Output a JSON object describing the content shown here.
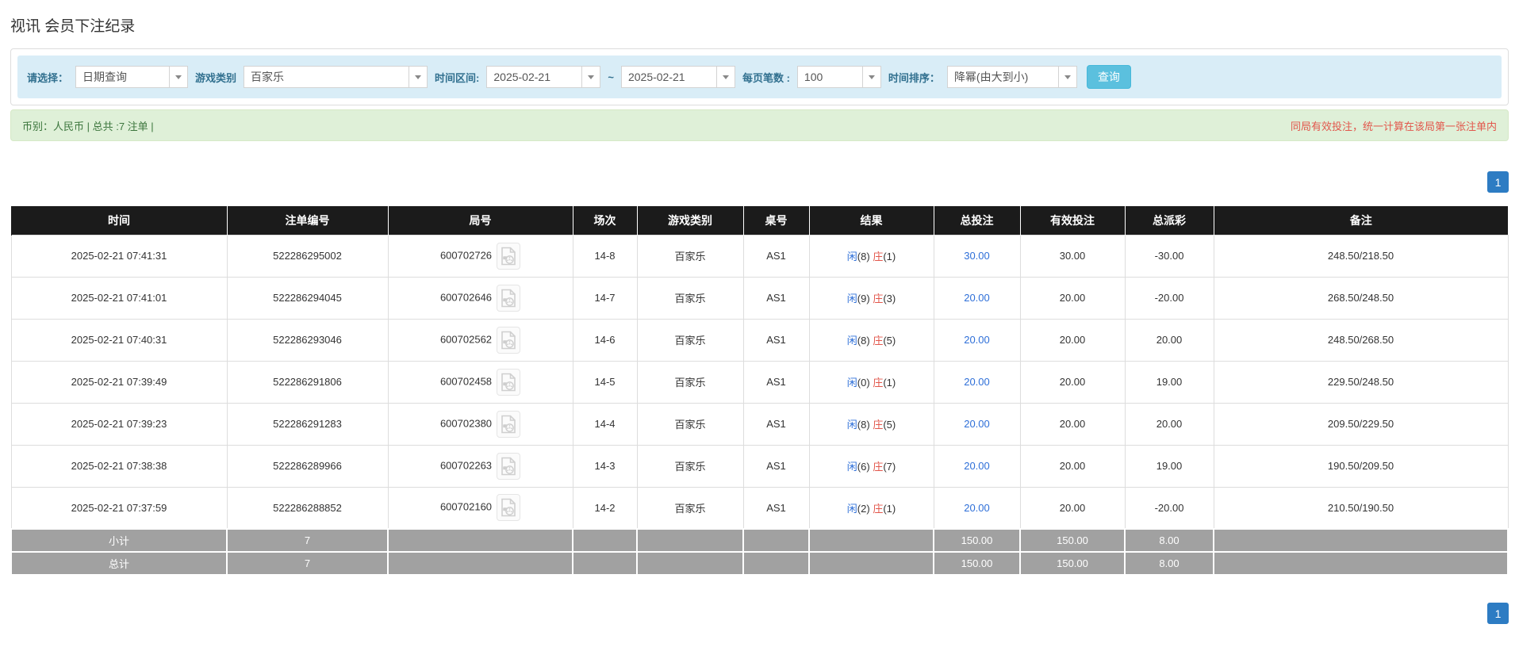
{
  "page": {
    "title": "视讯 会员下注纪录"
  },
  "filters": {
    "select_label": "请选择：",
    "select_value": "日期查询",
    "game_label": "游戏类别",
    "game_value": "百家乐",
    "range_label": "时间区间:",
    "date_from": "2025-02-21",
    "range_separator": "~",
    "date_to": "2025-02-21",
    "page_size_label": "每页笔数 :",
    "page_size_value": "100",
    "sort_label": "时间排序：",
    "sort_value": "降幂(由大到小)",
    "search_button": "查询"
  },
  "summary_bar": {
    "left_text": "币别：人民币 | 总共 :7 注单 |",
    "right_text": "同局有效投注，统一计算在该局第一张注单内"
  },
  "pagination": {
    "page": "1"
  },
  "table": {
    "headers": [
      "时间",
      "注单编号",
      "局号",
      "场次",
      "游戏类别",
      "桌号",
      "结果",
      "总投注",
      "有效投注",
      "总派彩",
      "备注"
    ],
    "rows": [
      {
        "time": "2025-02-21 07:41:31",
        "bet_no": "522286295002",
        "round_no": "600702726",
        "session": "14-8",
        "game": "百家乐",
        "table_no": "AS1",
        "player": "闲",
        "player_score": "(8)",
        "banker": "庄",
        "banker_score": "(1)",
        "total_bet": "30.00",
        "valid_bet": "30.00",
        "payout": "-30.00",
        "note": "248.50/218.50"
      },
      {
        "time": "2025-02-21 07:41:01",
        "bet_no": "522286294045",
        "round_no": "600702646",
        "session": "14-7",
        "game": "百家乐",
        "table_no": "AS1",
        "player": "闲",
        "player_score": "(9)",
        "banker": "庄",
        "banker_score": "(3)",
        "total_bet": "20.00",
        "valid_bet": "20.00",
        "payout": "-20.00",
        "note": "268.50/248.50"
      },
      {
        "time": "2025-02-21 07:40:31",
        "bet_no": "522286293046",
        "round_no": "600702562",
        "session": "14-6",
        "game": "百家乐",
        "table_no": "AS1",
        "player": "闲",
        "player_score": "(8)",
        "banker": "庄",
        "banker_score": "(5)",
        "total_bet": "20.00",
        "valid_bet": "20.00",
        "payout": "20.00",
        "note": "248.50/268.50"
      },
      {
        "time": "2025-02-21 07:39:49",
        "bet_no": "522286291806",
        "round_no": "600702458",
        "session": "14-5",
        "game": "百家乐",
        "table_no": "AS1",
        "player": "闲",
        "player_score": "(0)",
        "banker": "庄",
        "banker_score": "(1)",
        "total_bet": "20.00",
        "valid_bet": "20.00",
        "payout": "19.00",
        "note": "229.50/248.50"
      },
      {
        "time": "2025-02-21 07:39:23",
        "bet_no": "522286291283",
        "round_no": "600702380",
        "session": "14-4",
        "game": "百家乐",
        "table_no": "AS1",
        "player": "闲",
        "player_score": "(8)",
        "banker": "庄",
        "banker_score": "(5)",
        "total_bet": "20.00",
        "valid_bet": "20.00",
        "payout": "20.00",
        "note": "209.50/229.50"
      },
      {
        "time": "2025-02-21 07:38:38",
        "bet_no": "522286289966",
        "round_no": "600702263",
        "session": "14-3",
        "game": "百家乐",
        "table_no": "AS1",
        "player": "闲",
        "player_score": "(6)",
        "banker": "庄",
        "banker_score": "(7)",
        "total_bet": "20.00",
        "valid_bet": "20.00",
        "payout": "19.00",
        "note": "190.50/209.50"
      },
      {
        "time": "2025-02-21 07:37:59",
        "bet_no": "522286288852",
        "round_no": "600702160",
        "session": "14-2",
        "game": "百家乐",
        "table_no": "AS1",
        "player": "闲",
        "player_score": "(2)",
        "banker": "庄",
        "banker_score": "(1)",
        "total_bet": "20.00",
        "valid_bet": "20.00",
        "payout": "-20.00",
        "note": "210.50/190.50"
      }
    ],
    "subtotal": {
      "label": "小计",
      "count": "7",
      "total_bet": "150.00",
      "valid_bet": "150.00",
      "payout": "8.00"
    },
    "grand_total": {
      "label": "总计",
      "count": "7",
      "total_bet": "150.00",
      "valid_bet": "150.00",
      "payout": "8.00"
    }
  },
  "icons": {
    "combo_arrow": "chevron-down-icon",
    "round_video": "video-replay-icon"
  },
  "colors": {
    "filter_bar_bg": "#d9edf7",
    "filter_label": "#31708f",
    "search_button_bg": "#5bc0de",
    "info_bar_bg": "#dff0d8",
    "info_text_green": "#3c763d",
    "notice_red": "#e2574c",
    "header_bg": "#1b1b1b",
    "link_blue": "#2e6fd8",
    "negative_red": "#e2574c",
    "footer_gray": "#a1a1a1",
    "pagination_blue": "#2d7cc3"
  }
}
